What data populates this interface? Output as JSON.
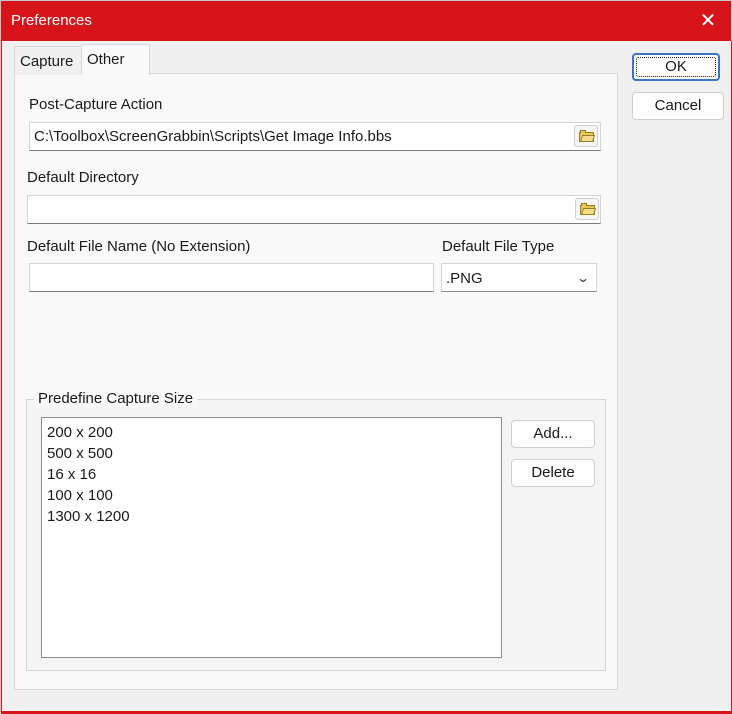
{
  "window": {
    "title": "Preferences"
  },
  "tabs": [
    {
      "label": "Capture"
    },
    {
      "label": "Other"
    }
  ],
  "other": {
    "post_capture_action": {
      "label": "Post-Capture Action",
      "value": "C:\\Toolbox\\ScreenGrabbin\\Scripts\\Get Image Info.bbs"
    },
    "default_directory": {
      "label": "Default Directory",
      "value": ""
    },
    "default_file_name": {
      "label": "Default File Name (No Extension)",
      "value": ""
    },
    "default_file_type": {
      "label": "Default File Type",
      "value": ".PNG"
    },
    "predefine": {
      "title": "Predefine Capture Size",
      "items": [
        "200 x 200",
        "500 x 500",
        "16 x 16",
        "100 x 100",
        "1300 x 1200"
      ],
      "add_label": "Add...",
      "delete_label": "Delete"
    }
  },
  "buttons": {
    "ok": "OK",
    "cancel": "Cancel"
  },
  "icons": {
    "close": "close-icon",
    "browse": "folder-icon",
    "dropdown": "chevron-down-icon"
  },
  "colors": {
    "titlebar": "#d7141a",
    "default_button_border": "#3a73c8"
  }
}
